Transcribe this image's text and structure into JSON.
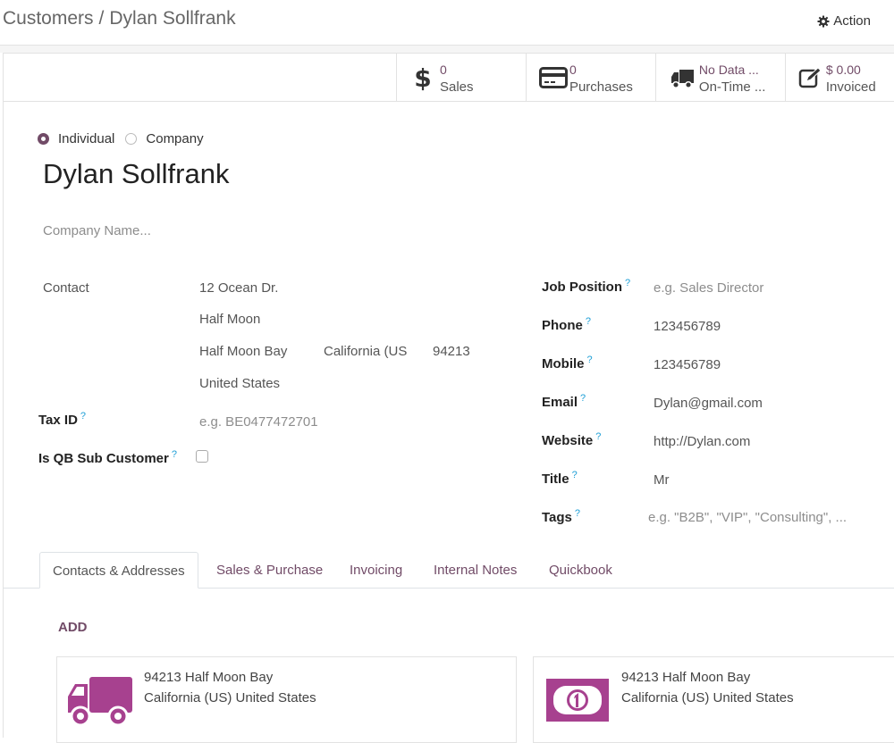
{
  "breadcrumb": {
    "parent": "Customers",
    "separator": "/",
    "current": "Dylan Sollfrank"
  },
  "action": {
    "label": "Action",
    "icon": "gear-icon"
  },
  "stats": [
    {
      "value": "0",
      "label": "Sales",
      "icon": "dollar-icon"
    },
    {
      "value": "0",
      "label": "Purchases",
      "icon": "credit-card-icon"
    },
    {
      "value": "No Data ...",
      "label": "On-Time ...",
      "icon": "truck-icon"
    },
    {
      "value": "$ 0.00",
      "label": "Invoiced",
      "icon": "edit-icon"
    }
  ],
  "partner_type": {
    "options": [
      "Individual",
      "Company"
    ],
    "selected": "Individual"
  },
  "name": "Dylan Sollfrank",
  "company_name_placeholder": "Company Name...",
  "left_fields": {
    "contact_label": "Contact",
    "address": {
      "street": "12 Ocean Dr.",
      "street2": "Half Moon",
      "city": "Half Moon Bay",
      "state": "California (US",
      "zip": "94213",
      "country": "United States"
    },
    "tax_id_label": "Tax ID",
    "tax_id_placeholder": "e.g. BE0477472701",
    "qb_sub_label": "Is QB Sub Customer",
    "qb_sub_checked": false
  },
  "right_fields": [
    {
      "label": "Job Position",
      "value": "",
      "placeholder": "e.g. Sales Director"
    },
    {
      "label": "Phone",
      "value": "123456789"
    },
    {
      "label": "Mobile",
      "value": "123456789"
    },
    {
      "label": "Email",
      "value": "Dylan@gmail.com"
    },
    {
      "label": "Website",
      "value": "http://Dylan.com"
    },
    {
      "label": "Title",
      "value": "Mr"
    },
    {
      "label": "Tags",
      "value": "",
      "placeholder": "e.g. \"B2B\", \"VIP\", \"Consulting\", ..."
    }
  ],
  "help_marker": "?",
  "tabs": [
    "Contacts & Addresses",
    "Sales & Purchase",
    "Invoicing",
    "Internal Notes",
    "Quickbook"
  ],
  "active_tab": "Contacts & Addresses",
  "add_label": "ADD",
  "address_cards": [
    {
      "icon": "delivery-truck-icon",
      "line1": "94213 Half Moon Bay",
      "line2": "California (US) United States"
    },
    {
      "icon": "money-bill-icon",
      "line1": "94213 Half Moon Bay",
      "line2": "California (US) United States"
    }
  ],
  "colors": {
    "brand": "#714b67",
    "card_icon": "#a7418f",
    "help": "#1f9fd6"
  }
}
